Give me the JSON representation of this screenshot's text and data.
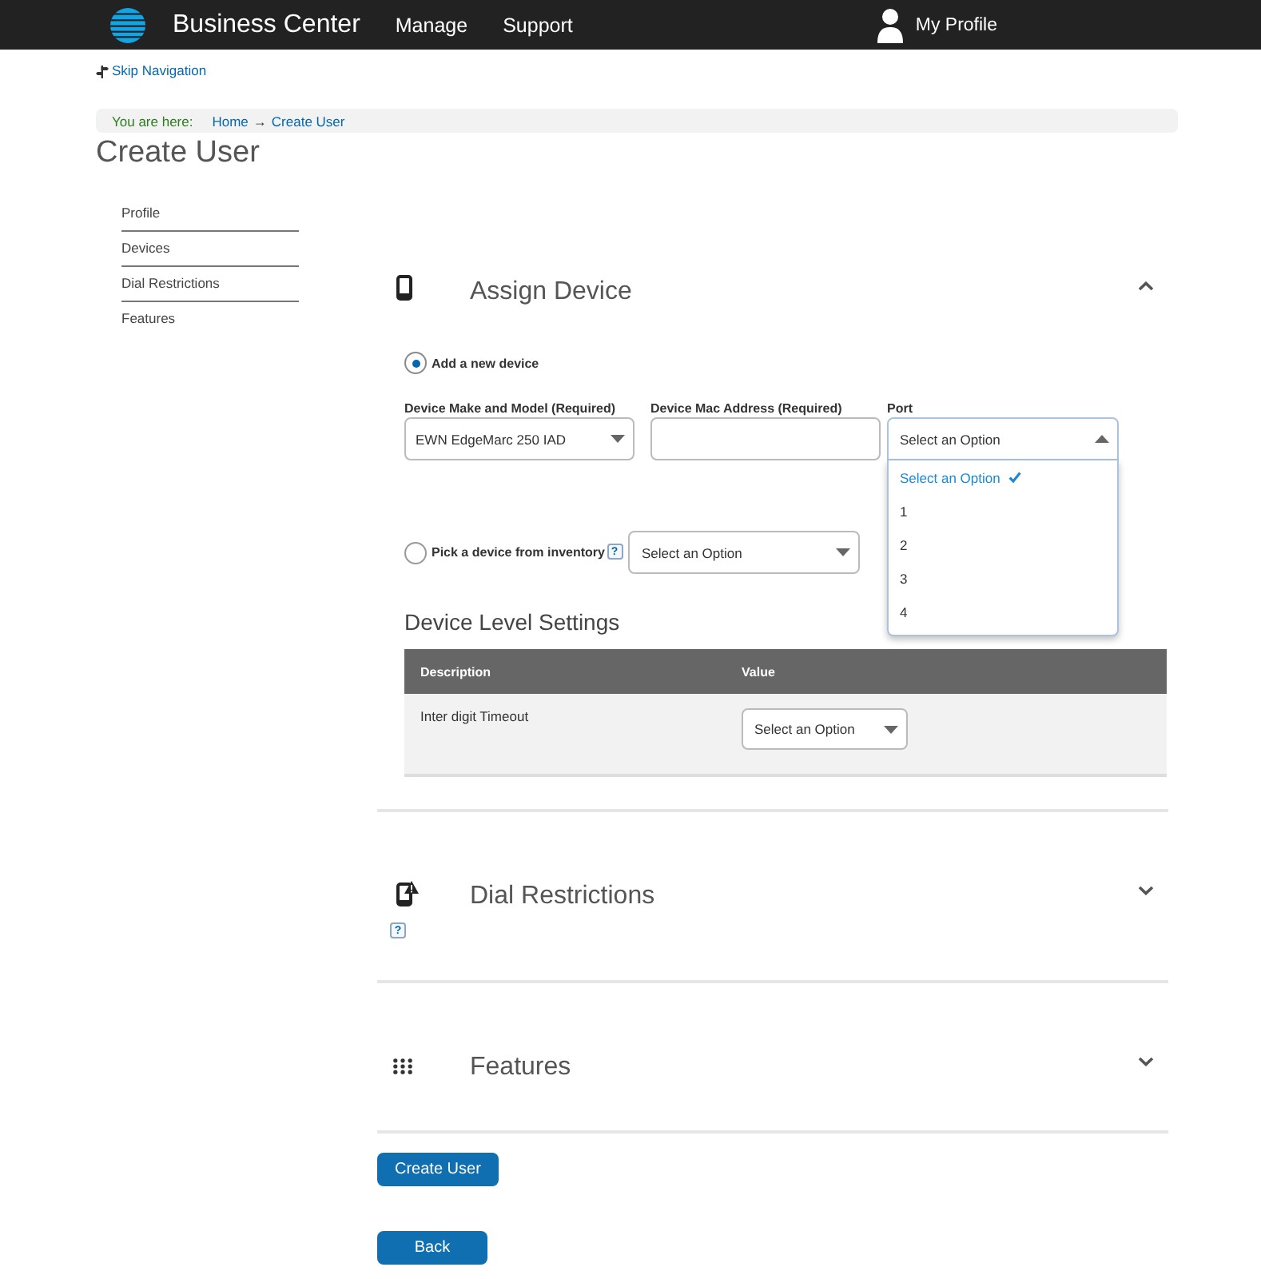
{
  "header": {
    "brand": "Business Center",
    "nav": [
      {
        "label": "Manage"
      },
      {
        "label": "Support"
      }
    ],
    "profile": "My Profile"
  },
  "skip_link": "Skip Navigation",
  "breadcrumb": {
    "label": "You are here:",
    "links": [
      "Home",
      "Create User"
    ],
    "separator": "→"
  },
  "page_title": "Create User",
  "sidebar": {
    "items": [
      {
        "label": "Profile"
      },
      {
        "label": "Devices"
      },
      {
        "label": "Dial Restrictions"
      },
      {
        "label": "Features"
      }
    ]
  },
  "sections": [
    {
      "kind": "device",
      "title": "Assign Device",
      "expanded": true,
      "content": {
        "sources": [
          {
            "label": "Add a new device",
            "selected": true,
            "fields": [
              {
                "kind": "select",
                "label": "Device Make and Model (Required)",
                "value": "EWN EdgeMarc 250 IAD",
                "expanded": false
              },
              {
                "kind": "text",
                "label": "Device Mac Address (Required)"
              },
              {
                "kind": "select",
                "label": "Port",
                "value": "Select an Option",
                "expanded": true,
                "options": [
                  {
                    "label": "Select an Option",
                    "selected": true
                  },
                  {
                    "label": "1",
                    "selected": false
                  },
                  {
                    "label": "2",
                    "selected": false
                  },
                  {
                    "label": "3",
                    "selected": false
                  },
                  {
                    "label": "4",
                    "selected": false
                  }
                ]
              }
            ]
          },
          {
            "label": "Pick a device from inventory",
            "selected": false,
            "help": "?",
            "select": {
              "value": "Select an Option",
              "expanded": false
            }
          }
        ],
        "settings": {
          "title": "Device Level Settings",
          "columns": [
            "Description",
            "Value"
          ],
          "rows": [
            {
              "description": "Inter digit Timeout",
              "select": {
                "value": "Select an Option",
                "expanded": false
              }
            }
          ]
        }
      }
    },
    {
      "kind": "restrictions",
      "title": "Dial Restrictions",
      "expanded": false,
      "help": "?"
    },
    {
      "kind": "features",
      "title": "Features",
      "expanded": false
    }
  ],
  "buttons": [
    {
      "label": "Create User"
    },
    {
      "label": "Back"
    }
  ]
}
